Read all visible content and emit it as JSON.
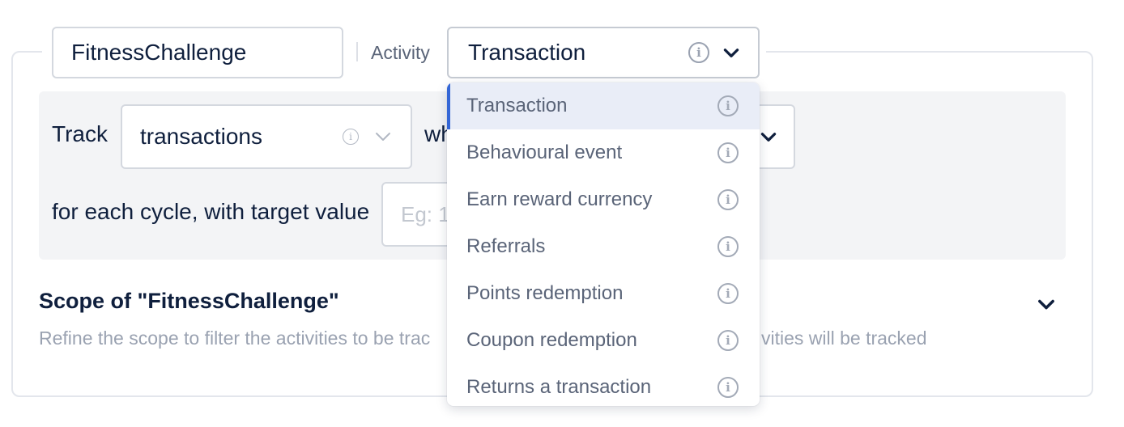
{
  "header": {
    "name_value": "FitnessChallenge",
    "activity_label": "Activity",
    "activity_value": "Transaction"
  },
  "track": {
    "label": "Track",
    "select_value": "transactions",
    "when_text": "wh",
    "cycle_text": "for each cycle, with target value",
    "target_placeholder": "Eg: 1"
  },
  "scope": {
    "title": "Scope of \"FitnessChallenge\"",
    "desc_left": "Refine the scope to filter the activities to be trac",
    "desc_right": "vities will be tracked"
  },
  "dropdown": {
    "options": [
      {
        "label": "Transaction"
      },
      {
        "label": "Behavioural event"
      },
      {
        "label": "Earn reward currency"
      },
      {
        "label": "Referrals"
      },
      {
        "label": "Points redemption"
      },
      {
        "label": "Coupon redemption"
      },
      {
        "label": "Returns a transaction"
      }
    ],
    "selected": "Transaction"
  },
  "icons": {
    "info": "info-icon",
    "chevron": "chevron-down-icon"
  },
  "colors": {
    "accent": "#3466d6",
    "panel": "#f3f4f6",
    "text": "#0f1f3d",
    "muted": "#9aa2b1"
  }
}
